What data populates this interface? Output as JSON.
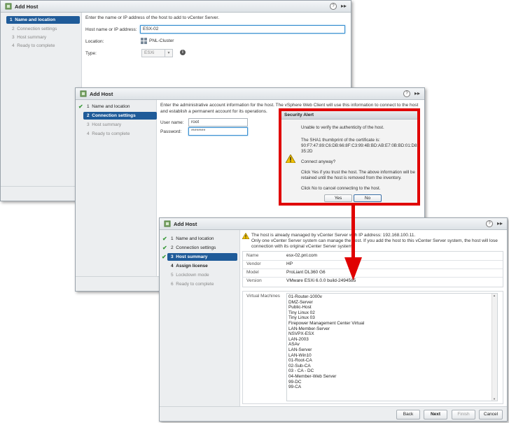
{
  "dialog1": {
    "title": "Add Host",
    "steps": [
      {
        "num": "1",
        "label": "Name and location"
      },
      {
        "num": "2",
        "label": "Connection settings"
      },
      {
        "num": "3",
        "label": "Host summary"
      },
      {
        "num": "4",
        "label": "Ready to complete"
      }
    ],
    "instruction": "Enter the name or IP address of the host to add to vCenter Server.",
    "host_label": "Host name or IP address:",
    "host_value": "ESX-02",
    "location_label": "Location:",
    "location_value": "PNL-Cluster",
    "type_label": "Type:",
    "type_value": "ESXi"
  },
  "dialog2": {
    "title": "Add Host",
    "steps": [
      {
        "num": "1",
        "label": "Name and location"
      },
      {
        "num": "2",
        "label": "Connection settings"
      },
      {
        "num": "3",
        "label": "Host summary"
      },
      {
        "num": "4",
        "label": "Ready to complete"
      }
    ],
    "instruction_line1": "Enter the administrative account information for the host. The vSphere Web Client will use this information to connect to the host",
    "instruction_line2": "and establish a permanent account for its operations.",
    "username_label": "User name:",
    "username_value": "root",
    "password_label": "Password:",
    "password_value": "********"
  },
  "security_alert": {
    "title": "Security Alert",
    "line1": "Unable to verify the authenticity of the host.",
    "line2": "The SHA1 thumbprint of the certificate is:",
    "line3": "90:F7:47:89:C6:DB:66:8F:C3:99:4B:BD:AB:E7:0B:BD:01:D8:",
    "line4": "35:2D",
    "line5": "Connect anyway?",
    "line6": "Click Yes if you trust the host. The above information will be",
    "line7": "retained until the host is removed from the inventory.",
    "line8": "Click No to cancel connecting to the host.",
    "yes_label": "Yes",
    "no_label": "No"
  },
  "dialog3": {
    "title": "Add Host",
    "steps": [
      {
        "num": "1",
        "label": "Name and location"
      },
      {
        "num": "2",
        "label": "Connection settings"
      },
      {
        "num": "3",
        "label": "Host summary"
      },
      {
        "num": "4",
        "label": "Assign license"
      },
      {
        "num": "5",
        "label": "Lockdown mode"
      },
      {
        "num": "6",
        "label": "Ready to complete"
      }
    ],
    "warning_line1": "The host is already managed by vCenter Server with IP address: 192.168.100.11.",
    "warning_line2": "Only one vCenter Server system can manage the host. If you add the host to this vCenter Server system, the host will lose",
    "warning_line3": "connection with its original vCenter Server system.",
    "summary": [
      {
        "key": "Name",
        "value": "esx-02.pnl.com"
      },
      {
        "key": "Vendor",
        "value": "HP"
      },
      {
        "key": "Model",
        "value": "ProLiant DL360 G6"
      },
      {
        "key": "Version",
        "value": "VMware ESXi 6.0.0 build-2494585"
      }
    ],
    "vm_label": "Virtual Machines",
    "vms": [
      "01-Router-1000v",
      "DMZ-Server",
      "Public-Host",
      "Tiny Linux 02",
      "Tiny Linux 03",
      "Firepower Management Center Virtual",
      "LAN-Member-Server",
      "NSVPX-ESX",
      "LAN-2003",
      "ASAv",
      "LAN-Server",
      "LAN-Win10",
      "01-Root-CA",
      "02-Sub-CA",
      "03 - CA - DC",
      "04-Member-Web Server",
      "99-DC",
      "99-CA"
    ],
    "buttons": {
      "back": "Back",
      "next": "Next",
      "finish": "Finish",
      "cancel": "Cancel"
    }
  },
  "colors": {
    "accent": "#1f5b99",
    "highlight": "#e00000",
    "check": "#3a9a3a"
  }
}
